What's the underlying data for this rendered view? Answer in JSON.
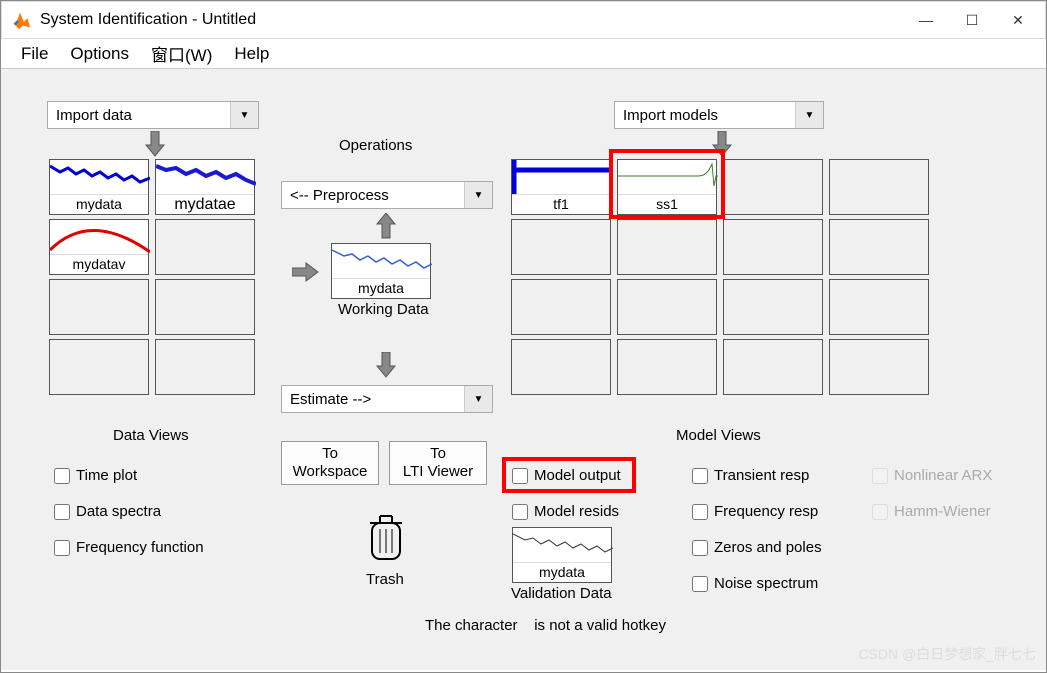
{
  "window": {
    "title": "System Identification - Untitled"
  },
  "menu": {
    "file": "File",
    "options": "Options",
    "window": "窗口(W)",
    "help": "Help"
  },
  "importData": {
    "label": "Import data"
  },
  "importModels": {
    "label": "Import models"
  },
  "operationsLabel": "Operations",
  "preprocess": {
    "label": "<-- Preprocess"
  },
  "estimate": {
    "label": "Estimate -->"
  },
  "workingData": {
    "caption": "Working Data",
    "name": "mydata"
  },
  "validationData": {
    "caption": "Validation Data",
    "name": "mydata"
  },
  "dataSlots": {
    "s0": "mydata",
    "s1": "mydatae",
    "s2": "mydatav"
  },
  "modelSlots": {
    "m0": "tf1",
    "m1": "ss1"
  },
  "buttons": {
    "toWorkspace": "To\nWorkspace",
    "toLTI": "To\nLTI Viewer",
    "trash": "Trash"
  },
  "sections": {
    "dataViews": "Data Views",
    "modelViews": "Model Views"
  },
  "checks": {
    "timePlot": "Time plot",
    "dataSpectra": "Data spectra",
    "freqFunc": "Frequency function",
    "modelOutput": "Model output",
    "modelResids": "Model resids",
    "transient": "Transient resp",
    "freqResp": "Frequency resp",
    "zerosPoles": "Zeros and poles",
    "noiseSpec": "Noise spectrum",
    "nlArx": "Nonlinear ARX",
    "hammWiener": "Hamm-Wiener"
  },
  "statusMsg": "The character    is not a valid hotkey",
  "watermark": "CSDN @白日梦想家_胖七七"
}
